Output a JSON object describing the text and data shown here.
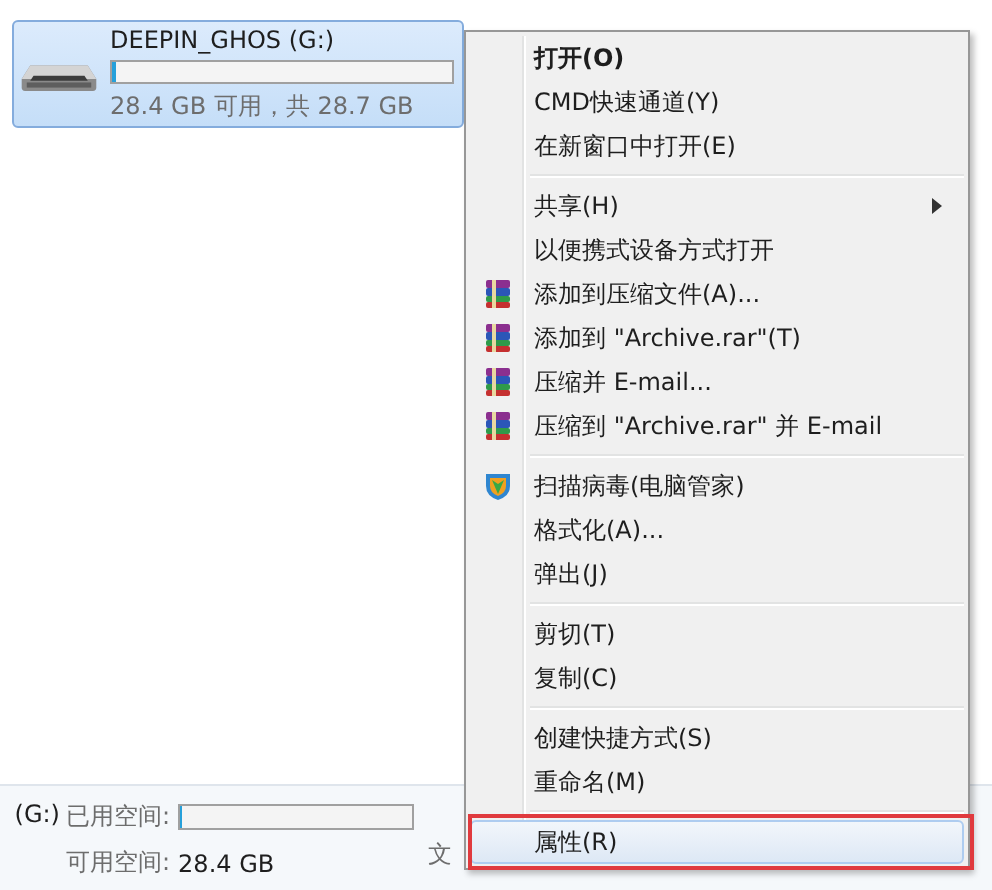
{
  "drive": {
    "name": "DEEPIN_GHOS (G:)",
    "level": 0.01,
    "space": "28.4 GB 可用，共 28.7 GB",
    "selected": true
  },
  "details": {
    "name": "(G:)",
    "used_label": "已用空间:",
    "level": 0.01,
    "free_label": "可用空间:",
    "free_value": "28.4 GB",
    "column_3": "文"
  },
  "menu": [
    {
      "kind": "command",
      "label": "打开(O)",
      "bold": true,
      "submenu": false,
      "selected": false,
      "marked": false
    },
    {
      "kind": "command",
      "label": "CMD快速通道(Y)",
      "bold": false,
      "submenu": false,
      "selected": false,
      "marked": false
    },
    {
      "kind": "command",
      "label": "在新窗口中打开(E)",
      "bold": false,
      "submenu": false,
      "selected": false,
      "marked": false
    },
    {
      "kind": "separator"
    },
    {
      "kind": "command",
      "label": "共享(H)",
      "bold": false,
      "submenu": true,
      "selected": false,
      "marked": false
    },
    {
      "kind": "command",
      "label": "以便携式设备方式打开",
      "bold": false,
      "submenu": false,
      "selected": false,
      "marked": false
    },
    {
      "kind": "archive",
      "label": "添加到压缩文件(A)...",
      "bold": false,
      "submenu": false,
      "selected": false,
      "marked": false
    },
    {
      "kind": "archive",
      "label": "添加到 \"Archive.rar\"(T)",
      "bold": false,
      "submenu": false,
      "selected": false,
      "marked": false
    },
    {
      "kind": "archive",
      "label": "压缩并 E-mail...",
      "bold": false,
      "submenu": false,
      "selected": false,
      "marked": false
    },
    {
      "kind": "archive",
      "label": "压缩到 \"Archive.rar\" 并 E-mail",
      "bold": false,
      "submenu": false,
      "selected": false,
      "marked": false
    },
    {
      "kind": "separator"
    },
    {
      "kind": "scan",
      "label": "扫描病毒(电脑管家)",
      "bold": false,
      "submenu": false,
      "selected": false,
      "marked": false
    },
    {
      "kind": "command",
      "label": "格式化(A)...",
      "bold": false,
      "submenu": false,
      "selected": false,
      "marked": false
    },
    {
      "kind": "command",
      "label": "弹出(J)",
      "bold": false,
      "submenu": false,
      "selected": false,
      "marked": false
    },
    {
      "kind": "separator"
    },
    {
      "kind": "command",
      "label": "剪切(T)",
      "bold": false,
      "submenu": false,
      "selected": false,
      "marked": false
    },
    {
      "kind": "command",
      "label": "复制(C)",
      "bold": false,
      "submenu": false,
      "selected": false,
      "marked": false
    },
    {
      "kind": "separator"
    },
    {
      "kind": "command",
      "label": "创建快捷方式(S)",
      "bold": false,
      "submenu": false,
      "selected": false,
      "marked": false
    },
    {
      "kind": "command",
      "label": "重命名(M)",
      "bold": false,
      "submenu": false,
      "selected": false,
      "marked": false
    },
    {
      "kind": "separator"
    },
    {
      "kind": "command",
      "label": "属性(R)",
      "bold": false,
      "submenu": false,
      "selected": true,
      "marked": true
    }
  ]
}
